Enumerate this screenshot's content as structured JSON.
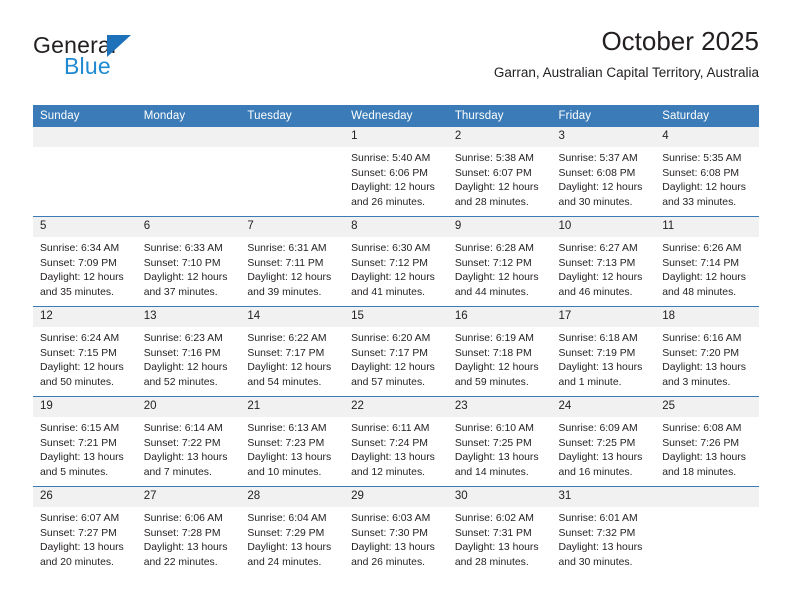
{
  "brand": {
    "name_top": "General",
    "name_bottom": "Blue",
    "accent_blue": "#1d71b8",
    "light_blue": "#1f8ad2"
  },
  "header": {
    "title": "October 2025",
    "subtitle": "Garran, Australian Capital Territory, Australia"
  },
  "theme": {
    "header_bg": "#3b7cb8",
    "daynum_bg": "#f1f1f1",
    "text": "#231f20"
  },
  "weekdays": [
    "Sunday",
    "Monday",
    "Tuesday",
    "Wednesday",
    "Thursday",
    "Friday",
    "Saturday"
  ],
  "weeks": [
    [
      {
        "day": "",
        "empty": true
      },
      {
        "day": "",
        "empty": true
      },
      {
        "day": "",
        "empty": true
      },
      {
        "day": "1",
        "sunrise": "Sunrise: 5:40 AM",
        "sunset": "Sunset: 6:06 PM",
        "daylight1": "Daylight: 12 hours",
        "daylight2": "and 26 minutes."
      },
      {
        "day": "2",
        "sunrise": "Sunrise: 5:38 AM",
        "sunset": "Sunset: 6:07 PM",
        "daylight1": "Daylight: 12 hours",
        "daylight2": "and 28 minutes."
      },
      {
        "day": "3",
        "sunrise": "Sunrise: 5:37 AM",
        "sunset": "Sunset: 6:08 PM",
        "daylight1": "Daylight: 12 hours",
        "daylight2": "and 30 minutes."
      },
      {
        "day": "4",
        "sunrise": "Sunrise: 5:35 AM",
        "sunset": "Sunset: 6:08 PM",
        "daylight1": "Daylight: 12 hours",
        "daylight2": "and 33 minutes."
      }
    ],
    [
      {
        "day": "5",
        "sunrise": "Sunrise: 6:34 AM",
        "sunset": "Sunset: 7:09 PM",
        "daylight1": "Daylight: 12 hours",
        "daylight2": "and 35 minutes."
      },
      {
        "day": "6",
        "sunrise": "Sunrise: 6:33 AM",
        "sunset": "Sunset: 7:10 PM",
        "daylight1": "Daylight: 12 hours",
        "daylight2": "and 37 minutes."
      },
      {
        "day": "7",
        "sunrise": "Sunrise: 6:31 AM",
        "sunset": "Sunset: 7:11 PM",
        "daylight1": "Daylight: 12 hours",
        "daylight2": "and 39 minutes."
      },
      {
        "day": "8",
        "sunrise": "Sunrise: 6:30 AM",
        "sunset": "Sunset: 7:12 PM",
        "daylight1": "Daylight: 12 hours",
        "daylight2": "and 41 minutes."
      },
      {
        "day": "9",
        "sunrise": "Sunrise: 6:28 AM",
        "sunset": "Sunset: 7:12 PM",
        "daylight1": "Daylight: 12 hours",
        "daylight2": "and 44 minutes."
      },
      {
        "day": "10",
        "sunrise": "Sunrise: 6:27 AM",
        "sunset": "Sunset: 7:13 PM",
        "daylight1": "Daylight: 12 hours",
        "daylight2": "and 46 minutes."
      },
      {
        "day": "11",
        "sunrise": "Sunrise: 6:26 AM",
        "sunset": "Sunset: 7:14 PM",
        "daylight1": "Daylight: 12 hours",
        "daylight2": "and 48 minutes."
      }
    ],
    [
      {
        "day": "12",
        "sunrise": "Sunrise: 6:24 AM",
        "sunset": "Sunset: 7:15 PM",
        "daylight1": "Daylight: 12 hours",
        "daylight2": "and 50 minutes."
      },
      {
        "day": "13",
        "sunrise": "Sunrise: 6:23 AM",
        "sunset": "Sunset: 7:16 PM",
        "daylight1": "Daylight: 12 hours",
        "daylight2": "and 52 minutes."
      },
      {
        "day": "14",
        "sunrise": "Sunrise: 6:22 AM",
        "sunset": "Sunset: 7:17 PM",
        "daylight1": "Daylight: 12 hours",
        "daylight2": "and 54 minutes."
      },
      {
        "day": "15",
        "sunrise": "Sunrise: 6:20 AM",
        "sunset": "Sunset: 7:17 PM",
        "daylight1": "Daylight: 12 hours",
        "daylight2": "and 57 minutes."
      },
      {
        "day": "16",
        "sunrise": "Sunrise: 6:19 AM",
        "sunset": "Sunset: 7:18 PM",
        "daylight1": "Daylight: 12 hours",
        "daylight2": "and 59 minutes."
      },
      {
        "day": "17",
        "sunrise": "Sunrise: 6:18 AM",
        "sunset": "Sunset: 7:19 PM",
        "daylight1": "Daylight: 13 hours",
        "daylight2": "and 1 minute."
      },
      {
        "day": "18",
        "sunrise": "Sunrise: 6:16 AM",
        "sunset": "Sunset: 7:20 PM",
        "daylight1": "Daylight: 13 hours",
        "daylight2": "and 3 minutes."
      }
    ],
    [
      {
        "day": "19",
        "sunrise": "Sunrise: 6:15 AM",
        "sunset": "Sunset: 7:21 PM",
        "daylight1": "Daylight: 13 hours",
        "daylight2": "and 5 minutes."
      },
      {
        "day": "20",
        "sunrise": "Sunrise: 6:14 AM",
        "sunset": "Sunset: 7:22 PM",
        "daylight1": "Daylight: 13 hours",
        "daylight2": "and 7 minutes."
      },
      {
        "day": "21",
        "sunrise": "Sunrise: 6:13 AM",
        "sunset": "Sunset: 7:23 PM",
        "daylight1": "Daylight: 13 hours",
        "daylight2": "and 10 minutes."
      },
      {
        "day": "22",
        "sunrise": "Sunrise: 6:11 AM",
        "sunset": "Sunset: 7:24 PM",
        "daylight1": "Daylight: 13 hours",
        "daylight2": "and 12 minutes."
      },
      {
        "day": "23",
        "sunrise": "Sunrise: 6:10 AM",
        "sunset": "Sunset: 7:25 PM",
        "daylight1": "Daylight: 13 hours",
        "daylight2": "and 14 minutes."
      },
      {
        "day": "24",
        "sunrise": "Sunrise: 6:09 AM",
        "sunset": "Sunset: 7:25 PM",
        "daylight1": "Daylight: 13 hours",
        "daylight2": "and 16 minutes."
      },
      {
        "day": "25",
        "sunrise": "Sunrise: 6:08 AM",
        "sunset": "Sunset: 7:26 PM",
        "daylight1": "Daylight: 13 hours",
        "daylight2": "and 18 minutes."
      }
    ],
    [
      {
        "day": "26",
        "sunrise": "Sunrise: 6:07 AM",
        "sunset": "Sunset: 7:27 PM",
        "daylight1": "Daylight: 13 hours",
        "daylight2": "and 20 minutes."
      },
      {
        "day": "27",
        "sunrise": "Sunrise: 6:06 AM",
        "sunset": "Sunset: 7:28 PM",
        "daylight1": "Daylight: 13 hours",
        "daylight2": "and 22 minutes."
      },
      {
        "day": "28",
        "sunrise": "Sunrise: 6:04 AM",
        "sunset": "Sunset: 7:29 PM",
        "daylight1": "Daylight: 13 hours",
        "daylight2": "and 24 minutes."
      },
      {
        "day": "29",
        "sunrise": "Sunrise: 6:03 AM",
        "sunset": "Sunset: 7:30 PM",
        "daylight1": "Daylight: 13 hours",
        "daylight2": "and 26 minutes."
      },
      {
        "day": "30",
        "sunrise": "Sunrise: 6:02 AM",
        "sunset": "Sunset: 7:31 PM",
        "daylight1": "Daylight: 13 hours",
        "daylight2": "and 28 minutes."
      },
      {
        "day": "31",
        "sunrise": "Sunrise: 6:01 AM",
        "sunset": "Sunset: 7:32 PM",
        "daylight1": "Daylight: 13 hours",
        "daylight2": "and 30 minutes."
      },
      {
        "day": "",
        "empty": true
      }
    ]
  ]
}
